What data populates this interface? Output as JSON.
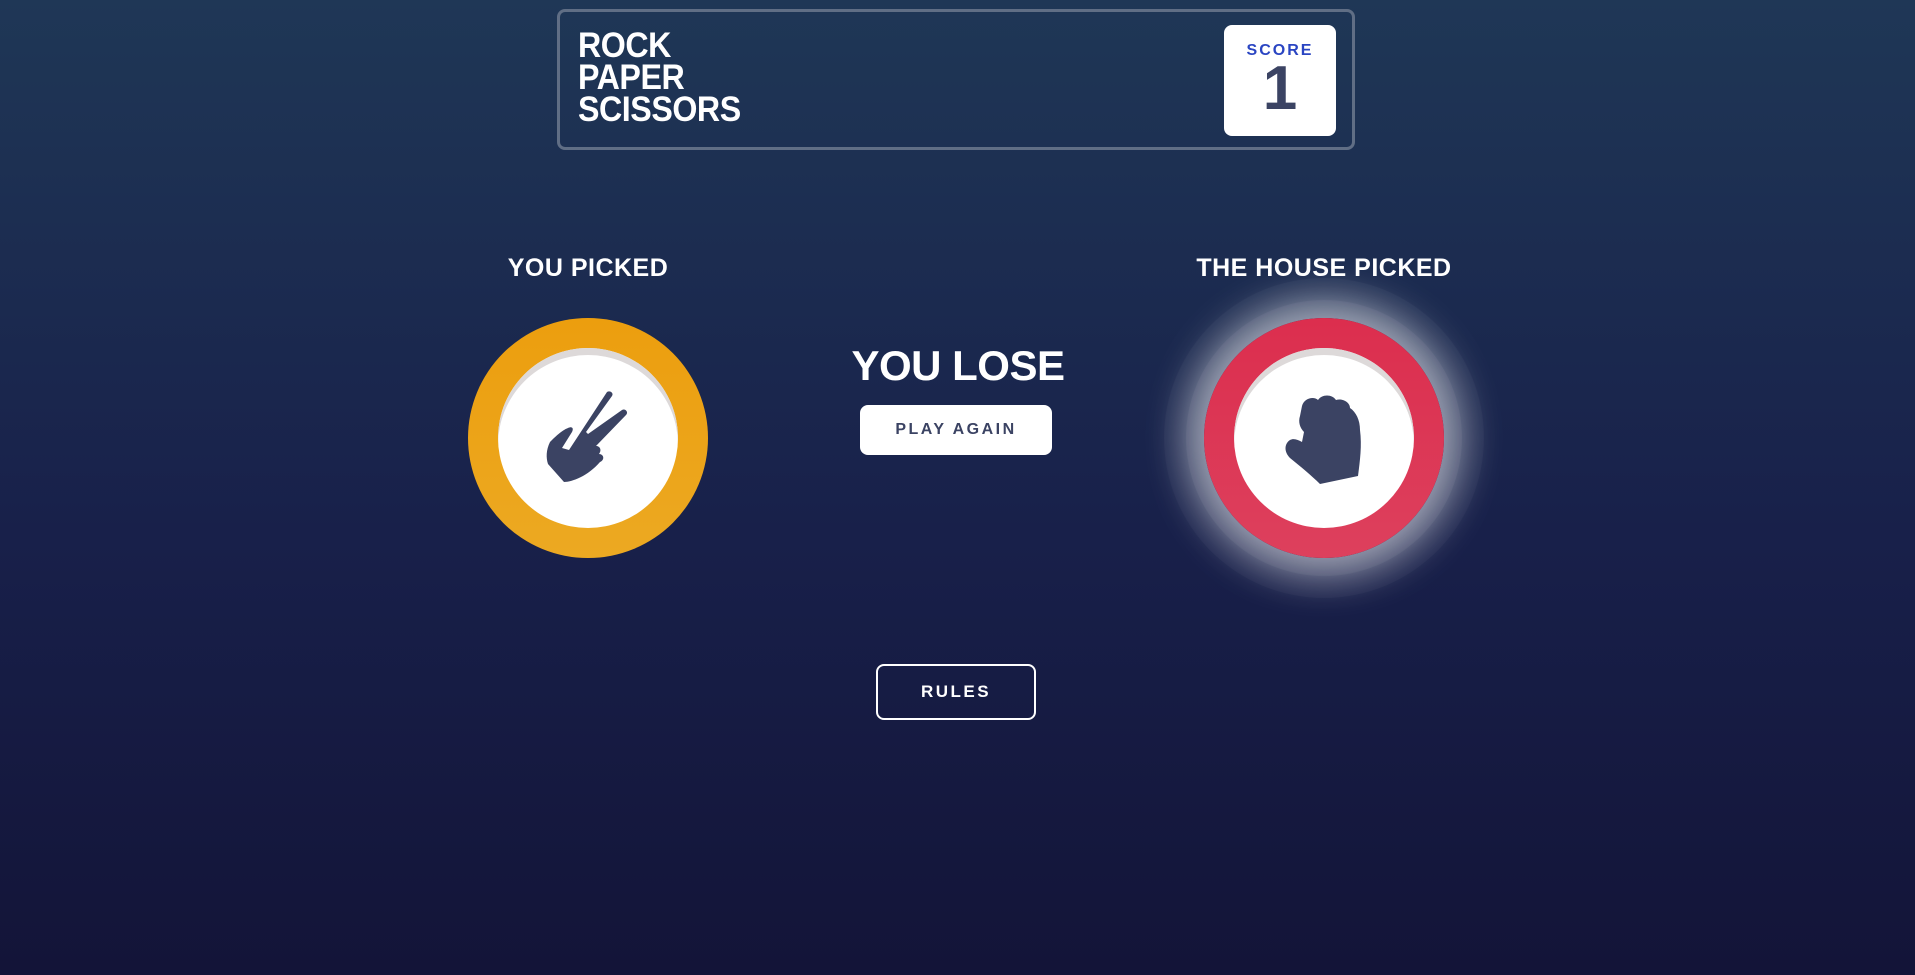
{
  "header": {
    "title_lines": [
      "ROCK",
      "PAPER",
      "SCISSORS"
    ],
    "score_label": "SCORE",
    "score_value": "1"
  },
  "game": {
    "player_label": "YOU PICKED",
    "house_label": "THE HOUSE PICKED",
    "player_pick": "scissors",
    "house_pick": "rock",
    "result_text": "YOU LOSE",
    "play_again_label": "PLAY AGAIN"
  },
  "footer": {
    "rules_label": "RULES"
  },
  "colors": {
    "scissors": "#ec9e0e",
    "rock": "#dc2e4e",
    "score_label": "#2a45c2",
    "dark_text": "#3b4363"
  }
}
